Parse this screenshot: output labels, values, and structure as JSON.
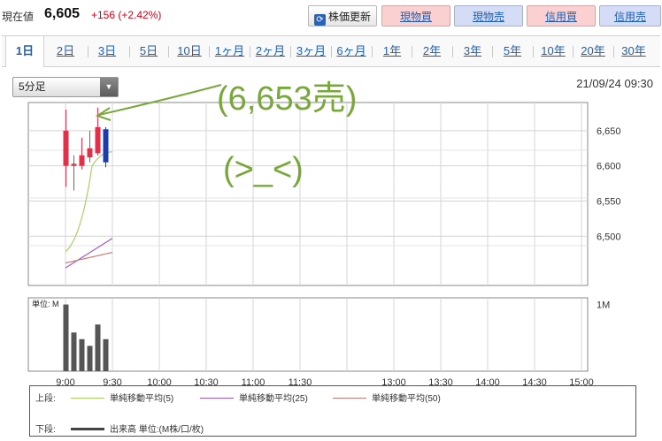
{
  "header": {
    "price_label": "現在値",
    "price": "6,605",
    "change": "+156 (+2.42%)",
    "refresh_label": "株価更新",
    "refresh_icon": "refresh-icon",
    "buttons": [
      {
        "label": "現物買",
        "type": "buy"
      },
      {
        "label": "現物売",
        "type": "sell"
      },
      {
        "label": "信用買",
        "type": "buy"
      },
      {
        "label": "信用売",
        "type": "sell"
      }
    ]
  },
  "tabs": [
    "1日",
    "2日",
    "3日",
    "5日",
    "10日",
    "1ヶ月",
    "2ヶ月",
    "3ヶ月",
    "6ヶ月",
    "1年",
    "2年",
    "3年",
    "5年",
    "10年",
    "20年",
    "30年"
  ],
  "active_tab": "1日",
  "interval_select": {
    "value": "5分足"
  },
  "datetime": "21/09/24 09:30",
  "annotations": {
    "sell_note": "(6,653売)",
    "emoticon": "(>_<)"
  },
  "colors": {
    "up_candle": "#e0304a",
    "down_candle": "#1a3cb0",
    "ma5": "#a8d064",
    "ma25": "#9a5bd0",
    "ma50": "#c87a70",
    "annotation": "#78a83a",
    "change": "#d0021b"
  },
  "chart_data": [
    {
      "type": "candlestick",
      "x": [
        "9:00",
        "9:05",
        "9:10",
        "9:15",
        "9:20",
        "9:25"
      ],
      "ohlc": [
        {
          "open": 6600,
          "high": 6680,
          "low": 6570,
          "close": 6650
        },
        {
          "open": 6600,
          "high": 6615,
          "low": 6565,
          "close": 6603
        },
        {
          "open": 6600,
          "high": 6640,
          "low": 6595,
          "close": 6615
        },
        {
          "open": 6612,
          "high": 6650,
          "low": 6605,
          "close": 6625
        },
        {
          "open": 6618,
          "high": 6683,
          "low": 6615,
          "close": 6655
        },
        {
          "open": 6652,
          "high": 6655,
          "low": 6598,
          "close": 6605
        }
      ],
      "moving_averages": [
        {
          "name": "単純移動平均(5)",
          "x": [
            "9:00",
            "9:30"
          ],
          "y": [
            6478,
            6620
          ]
        },
        {
          "name": "単純移動平均(25)",
          "x": [
            "9:00",
            "9:30"
          ],
          "y": [
            6455,
            6497
          ]
        },
        {
          "name": "単純移動平均(50)",
          "x": [
            "9:00",
            "9:30"
          ],
          "y": [
            6462,
            6477
          ]
        }
      ],
      "y_ticks": [
        "6,650",
        "6,600",
        "6,550",
        "6,500"
      ],
      "x_ticks": [
        "9:00",
        "9:30",
        "10:00",
        "10:30",
        "11:00",
        "11:30",
        "13:00",
        "13:30",
        "14:00",
        "14:30",
        "15:00"
      ],
      "ylim": [
        6430,
        6690
      ]
    },
    {
      "type": "bar",
      "unit_label": "単位: M",
      "y_tick": "1M",
      "x": [
        "9:00",
        "9:05",
        "9:10",
        "9:15",
        "9:20",
        "9:25"
      ],
      "values": [
        1.0,
        0.58,
        0.48,
        0.38,
        0.7,
        0.48
      ],
      "ylim": [
        0,
        1.1
      ]
    }
  ],
  "legend": {
    "upper_label": "上段:",
    "lower_label": "下段:",
    "items": [
      "単純移動平均(5)",
      "単純移動平均(25)",
      "単純移動平均(50)"
    ],
    "volume_item": "出来高 単位:(M株/口/枚)"
  }
}
